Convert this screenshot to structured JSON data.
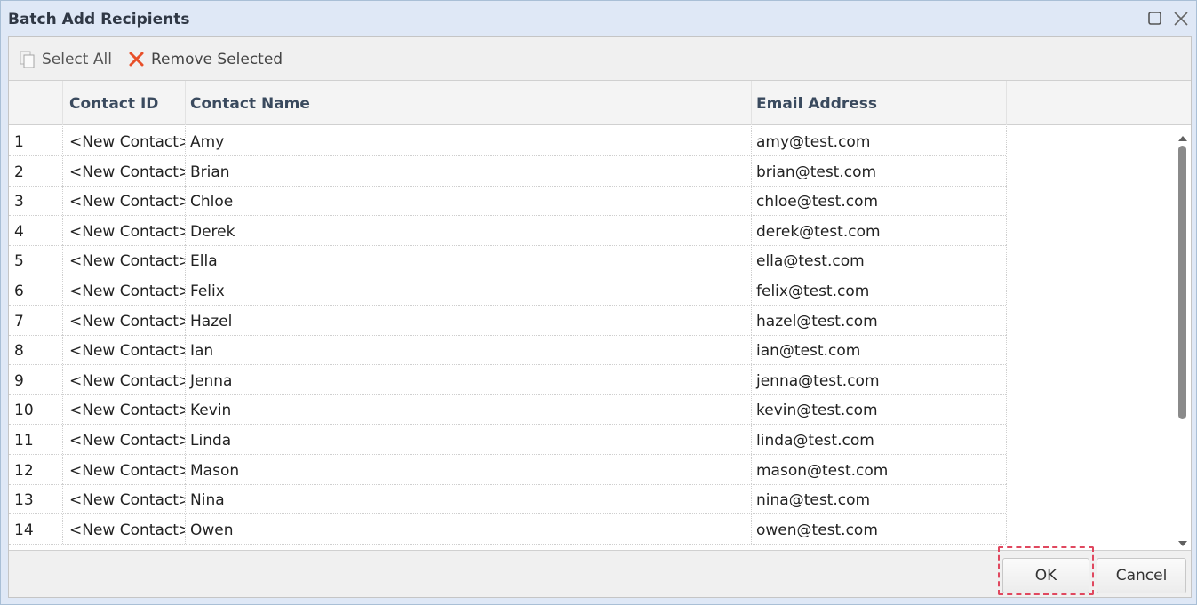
{
  "window": {
    "title": "Batch Add Recipients"
  },
  "toolbar": {
    "select_all_label": "Select All",
    "remove_selected_label": "Remove Selected"
  },
  "grid": {
    "columns": [
      "",
      "Contact ID",
      "Contact Name",
      "Email Address"
    ],
    "rows": [
      {
        "num": "1",
        "id": "<New Contact>",
        "name": "Amy",
        "email": "amy@test.com"
      },
      {
        "num": "2",
        "id": "<New Contact>",
        "name": "Brian",
        "email": "brian@test.com"
      },
      {
        "num": "3",
        "id": "<New Contact>",
        "name": "Chloe",
        "email": "chloe@test.com"
      },
      {
        "num": "4",
        "id": "<New Contact>",
        "name": "Derek",
        "email": "derek@test.com"
      },
      {
        "num": "5",
        "id": "<New Contact>",
        "name": "Ella",
        "email": "ella@test.com"
      },
      {
        "num": "6",
        "id": "<New Contact>",
        "name": "Felix",
        "email": "felix@test.com"
      },
      {
        "num": "7",
        "id": "<New Contact>",
        "name": "Hazel",
        "email": "hazel@test.com"
      },
      {
        "num": "8",
        "id": "<New Contact>",
        "name": "Ian",
        "email": "ian@test.com"
      },
      {
        "num": "9",
        "id": "<New Contact>",
        "name": "Jenna",
        "email": "jenna@test.com"
      },
      {
        "num": "10",
        "id": "<New Contact>",
        "name": "Kevin",
        "email": "kevin@test.com"
      },
      {
        "num": "11",
        "id": "<New Contact>",
        "name": "Linda",
        "email": "linda@test.com"
      },
      {
        "num": "12",
        "id": "<New Contact>",
        "name": "Mason",
        "email": "mason@test.com"
      },
      {
        "num": "13",
        "id": "<New Contact>",
        "name": "Nina",
        "email": "nina@test.com"
      },
      {
        "num": "14",
        "id": "<New Contact>",
        "name": "Owen",
        "email": "owen@test.com"
      }
    ]
  },
  "footer": {
    "ok_label": "OK",
    "cancel_label": "Cancel"
  },
  "icons": {
    "select_all": "copy-pages-icon",
    "remove_selected": "red-x-icon",
    "maximize": "maximize-icon",
    "close": "close-icon"
  },
  "colors": {
    "title_bar": "#dfe8f6",
    "header_text": "#3a4a5e",
    "remove_icon": "#e8502a",
    "ok_highlight": "#e0485f"
  }
}
